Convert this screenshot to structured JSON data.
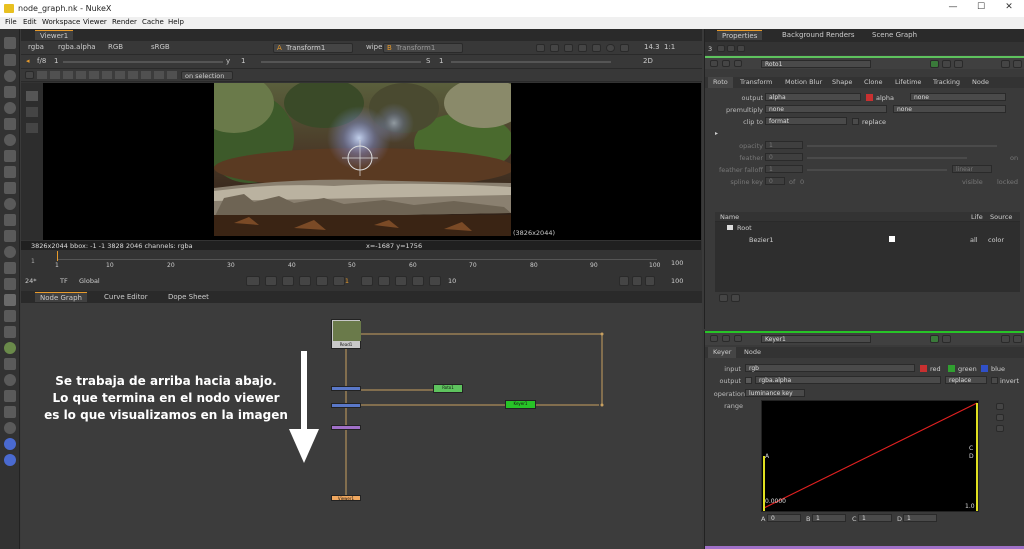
{
  "window": {
    "title": "node_graph.nk - NukeX",
    "minimize": "—",
    "maximize": "☐",
    "close": "✕"
  },
  "menu": [
    "File",
    "Edit",
    "Workspace",
    "Viewer",
    "Render",
    "Cache",
    "Help"
  ],
  "viewer": {
    "tab": "Viewer1",
    "channels": "rgba",
    "layer": "rgba.alpha",
    "mode": "RGB",
    "colorspace": "sRGB",
    "input_a": "Transform1",
    "wipe": "wipe",
    "input_b": "Transform1",
    "zoom": "14.3",
    "ratio": "1:1",
    "fstop": "f/8",
    "frame": "1",
    "y_label": "y",
    "y_value": "1",
    "s_label": "S",
    "s_value": "1",
    "view_mode": "2D",
    "update": "on selection",
    "resolution_label": "(3826x2044)",
    "info_left": "3826x2044  bbox: -1 -1 3828 2046 channels: rgba",
    "info_coords": "x=-1687 y=1756"
  },
  "timeline": {
    "ticks": [
      "1",
      "10",
      "20",
      "30",
      "40",
      "50",
      "60",
      "70",
      "80",
      "90",
      "100"
    ],
    "start": "1",
    "end": "100",
    "end2": "100",
    "fps": "24*",
    "tf": "TF",
    "scope": "Global",
    "current_frame": "1",
    "step": "10"
  },
  "bottom_tabs": [
    "Node Graph",
    "Curve Editor",
    "Dope Sheet"
  ],
  "nodes": {
    "read": "Read1",
    "roto": "Roto1",
    "keyer_node": "Keyer1",
    "viewer_node": "Viewer1"
  },
  "annotation": [
    "Se trabaja de arriba hacia abajo.",
    "Lo que termina en el nodo viewer",
    "es lo que visualizamos en la imagen"
  ],
  "properties": {
    "tabs": [
      "Properties",
      "Background Renders",
      "Scene Graph"
    ],
    "count": "3",
    "node_name": "Roto1",
    "subtabs": [
      "Roto",
      "Transform",
      "Motion Blur",
      "Shape",
      "Clone",
      "Lifetime",
      "Tracking",
      "Node"
    ],
    "output_label": "output",
    "output_value": "alpha",
    "alpha_check": "alpha",
    "none1": "none",
    "premult_label": "premultiply",
    "premult_value": "none",
    "none2": "none",
    "clip_label": "clip to",
    "clip_value": "format",
    "replace": "replace",
    "opacity_label": "opacity",
    "opacity_value": "1",
    "feather_label": "feather",
    "feather_value": "0",
    "on_label": "on",
    "falloff_label": "feather falloff",
    "falloff_value": "1",
    "falloff_type": "linear",
    "spline_label": "spline key",
    "spline_value": "0",
    "of_label": "of",
    "of_value": "0",
    "visible": "visible",
    "locked": "locked",
    "tree_headers": [
      "Name",
      "Life",
      "Source"
    ],
    "tree_root": "Root",
    "tree_bezier": "Bezier1",
    "bezier_life": "all",
    "bezier_source": "color"
  },
  "keyer": {
    "node_name": "Keyer1",
    "subtabs": [
      "Keyer",
      "Node"
    ],
    "input_label": "input",
    "input_value": "rgb",
    "red": "red",
    "green": "green",
    "blue": "blue",
    "output_label": "output",
    "output_value": "rgba.alpha",
    "output_mode": "replace",
    "invert": "invert",
    "operation_label": "operation",
    "operation_value": "luminance key",
    "range_label": "range",
    "graph_a": "A",
    "graph_b": "B",
    "graph_c": "C",
    "graph_d": "D",
    "graph_zero": "0.0000",
    "graph_one": "1.0",
    "a_label": "A",
    "a_value": "0",
    "b_label": "B",
    "b_value": "1",
    "c_label": "C",
    "c_value": "1",
    "d_label": "D",
    "d_value": "1"
  },
  "colors": {
    "accent": "#e89b2b",
    "roto_node": "#5ec35e",
    "keyer_node": "#27c427",
    "read_node": "#c8c8c8",
    "viewer_node": "#f0a860",
    "merge_node": "#8a8ad0",
    "roto_blue": "#5a78c8",
    "curve": "#e02020",
    "handles": "#e0e020"
  }
}
